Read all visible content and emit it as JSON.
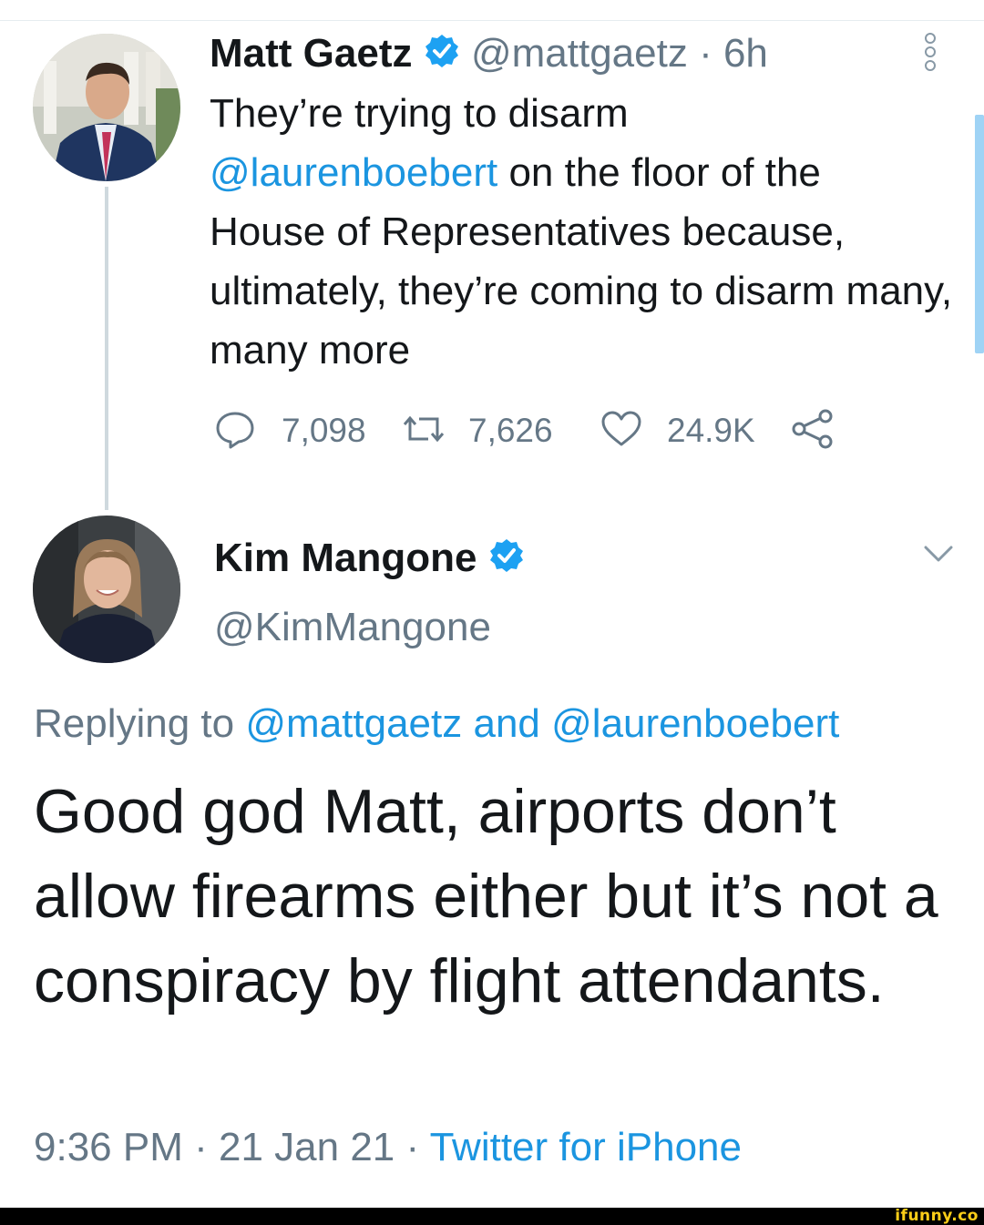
{
  "tweet1": {
    "display_name": "Matt Gaetz",
    "handle": "@mattgaetz",
    "separator": "·",
    "time_ago": "6h",
    "text_line1": "They’re trying to disarm",
    "mention": "@laurenboebert",
    "text_rest1": " on the floor of the",
    "text_rest2": "House of Representatives because, ultimately, they’re coming to disarm many, many more",
    "replies": "7,098",
    "retweets": "7,626",
    "likes": "24.9K"
  },
  "tweet2": {
    "display_name": "Kim Mangone",
    "handle": "@KimMangone",
    "replying_prefix": "Replying to",
    "reply_mention1": "@mattgaetz",
    "reply_and": "and",
    "reply_mention2": "@laurenboebert",
    "text": "Good god Matt, airports don’t allow firearms either but it’s not a conspiracy by flight attendants.",
    "time": "9:36 PM",
    "sep1": "·",
    "date": "21 Jan 21",
    "sep2": "·",
    "source": "Twitter for iPhone"
  },
  "watermark": "ifunny.co",
  "colors": {
    "link": "#1b95e0",
    "muted": "#657786",
    "text": "#14171a",
    "verified": "#1da1f2",
    "thread_line": "#cfd9de"
  },
  "icons": [
    "reply-icon",
    "retweet-icon",
    "like-icon",
    "share-icon",
    "verified-badge-icon",
    "more-options-icon",
    "chevron-down-icon"
  ]
}
